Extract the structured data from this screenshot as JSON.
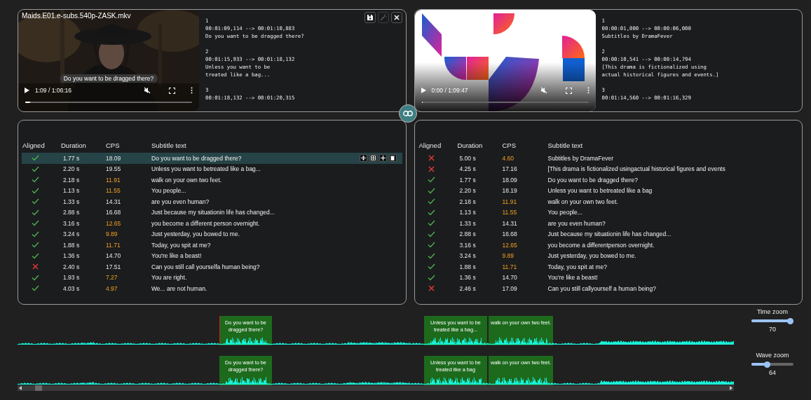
{
  "panels": [
    {
      "file_name": "Maids.E01.e-subs.540p-ZASK.mkv",
      "actions": [
        {
          "kind": "save",
          "disabled": false
        },
        {
          "kind": "wand",
          "disabled": true
        },
        {
          "kind": "close",
          "disabled": false
        }
      ],
      "video": {
        "kind": "drama",
        "caption": "Do you want to be dragged there?",
        "time": "1:09 / 1:06:16",
        "level": 0.03
      },
      "srt": [
        {
          "index": "1",
          "timing": "00:01:09,114 --> 00:01:10,883",
          "lines": [
            "Do you want to be dragged there?"
          ]
        },
        {
          "index": "2",
          "timing": "00:01:15,933 --> 00:01:18,132",
          "lines": [
            "Unless you want to be",
            "treated like a bag..."
          ]
        },
        {
          "index": "3",
          "timing": "00:01:18,132 --> 00:01:20,315"
        }
      ]
    },
    {
      "video": {
        "kind": "graphic",
        "time": "0:00 / 1:09:47",
        "level": 0
      },
      "srt": [
        {
          "index": "1",
          "timing": "00:00:01,000 --> 00:00:06,000",
          "lines": [
            "Subtitles by DramaFever"
          ]
        },
        {
          "index": "2",
          "timing": "00:00:10,541 --> 00:00:14,794",
          "lines": [
            "[This drama is fictionalized using",
            "actual historical figures and events.]"
          ]
        },
        {
          "index": "3",
          "timing": "00:01:14,560 --> 00:01:16,329"
        }
      ]
    }
  ],
  "tables": [
    {
      "columns": [
        "Aligned",
        "Duration",
        "CPS",
        "Subtitle text"
      ],
      "rows": [
        {
          "aligned": true,
          "duration": "1.77 s",
          "cps": "18.09",
          "cps_warning": false,
          "text": "Do you want to be dragged there?",
          "selected": true
        },
        {
          "aligned": true,
          "duration": "2.20 s",
          "cps": "19.55",
          "cps_warning": false,
          "text": "Unless you want to betreated like a bag...",
          "selected": false
        },
        {
          "aligned": true,
          "duration": "2.18 s",
          "cps": "11.91",
          "cps_warning": true,
          "text": "walk on your own two feet.",
          "selected": false
        },
        {
          "aligned": true,
          "duration": "1.13 s",
          "cps": "11.55",
          "cps_warning": true,
          "text": "You people...",
          "selected": false
        },
        {
          "aligned": true,
          "duration": "1.33 s",
          "cps": "14.31",
          "cps_warning": false,
          "text": "are you even human?",
          "selected": false
        },
        {
          "aligned": true,
          "duration": "2.88 s",
          "cps": "16.68",
          "cps_warning": false,
          "text": "Just because my situationin life has changed...",
          "selected": false
        },
        {
          "aligned": true,
          "duration": "3.16 s",
          "cps": "12.65",
          "cps_warning": true,
          "text": "you become a different person overnight.",
          "selected": false
        },
        {
          "aligned": true,
          "duration": "3.24 s",
          "cps": "9.89",
          "cps_warning": true,
          "text": "Just yesterday, you bowed to me.",
          "selected": false
        },
        {
          "aligned": true,
          "duration": "1.88 s",
          "cps": "11.71",
          "cps_warning": true,
          "text": "Today, you spit at me?",
          "selected": false
        },
        {
          "aligned": true,
          "duration": "1.36 s",
          "cps": "14.70",
          "cps_warning": false,
          "text": "You're like a beast!",
          "selected": false
        },
        {
          "aligned": false,
          "duration": "2.40 s",
          "cps": "17.51",
          "cps_warning": false,
          "text": "Can you still call yourselfa human being?",
          "selected": false
        },
        {
          "aligned": true,
          "duration": "1.93 s",
          "cps": "7.27",
          "cps_warning": true,
          "text": "You are right.",
          "selected": false
        },
        {
          "aligned": true,
          "duration": "4.03 s",
          "cps": "4.97",
          "cps_warning": true,
          "text": "We... are not human.",
          "selected": false
        }
      ]
    },
    {
      "columns": [
        "Aligned",
        "Duration",
        "CPS",
        "Subtitle text"
      ],
      "rows": [
        {
          "aligned": false,
          "duration": "5.00 s",
          "cps": "4.60",
          "cps_warning": true,
          "text": "Subtitles by DramaFever",
          "selected": false
        },
        {
          "aligned": false,
          "duration": "4.25 s",
          "cps": "17.16",
          "cps_warning": false,
          "text": "[This drama is fictionalized usingactual historical figures and events",
          "selected": false
        },
        {
          "aligned": true,
          "duration": "1.77 s",
          "cps": "18.09",
          "cps_warning": false,
          "text": "Do you want to be dragged there?",
          "selected": false
        },
        {
          "aligned": true,
          "duration": "2.20 s",
          "cps": "18.19",
          "cps_warning": false,
          "text": "Unless you want to betreated like a bag",
          "selected": false
        },
        {
          "aligned": true,
          "duration": "2.18 s",
          "cps": "11.91",
          "cps_warning": true,
          "text": "walk on your own two feet.",
          "selected": false
        },
        {
          "aligned": true,
          "duration": "1.13 s",
          "cps": "11.55",
          "cps_warning": true,
          "text": "You people...",
          "selected": false
        },
        {
          "aligned": true,
          "duration": "1.33 s",
          "cps": "14.31",
          "cps_warning": false,
          "text": "are you even human?",
          "selected": false
        },
        {
          "aligned": true,
          "duration": "2.88 s",
          "cps": "16.68",
          "cps_warning": false,
          "text": "Just because my situationin life has changed...",
          "selected": false
        },
        {
          "aligned": true,
          "duration": "3.16 s",
          "cps": "12.65",
          "cps_warning": true,
          "text": "you become a differentperson overnight.",
          "selected": false
        },
        {
          "aligned": true,
          "duration": "3.24 s",
          "cps": "9.89",
          "cps_warning": true,
          "text": "Just yesterday, you bowed to me.",
          "selected": false
        },
        {
          "aligned": true,
          "duration": "1.88 s",
          "cps": "11.71",
          "cps_warning": true,
          "text": "Today, you spit at me?",
          "selected": false
        },
        {
          "aligned": true,
          "duration": "1.36 s",
          "cps": "14.70",
          "cps_warning": false,
          "text": "You're like a beast!",
          "selected": false
        },
        {
          "aligned": false,
          "duration": "2.46 s",
          "cps": "17.09",
          "cps_warning": false,
          "text": "Can you still callyourself a human being?",
          "selected": false
        }
      ]
    }
  ],
  "waveforms": [
    {
      "blocks": [
        {
          "text": "Do you want to be dragged there?"
        },
        {
          "text": "Unless you want to be treated like a bag..."
        },
        {
          "text": "walk on your own two feet."
        }
      ]
    },
    {
      "blocks": [
        {
          "text": "Do you want to be dragged there?"
        },
        {
          "text": "Unless you want to be treated like a bag"
        },
        {
          "text": "walk on your own two feet."
        }
      ]
    }
  ],
  "sliders": [
    {
      "label": "Time zoom",
      "level": 0.93,
      "value": "70"
    },
    {
      "label": "Wave zoom",
      "level": 0.38,
      "value": "64"
    }
  ]
}
